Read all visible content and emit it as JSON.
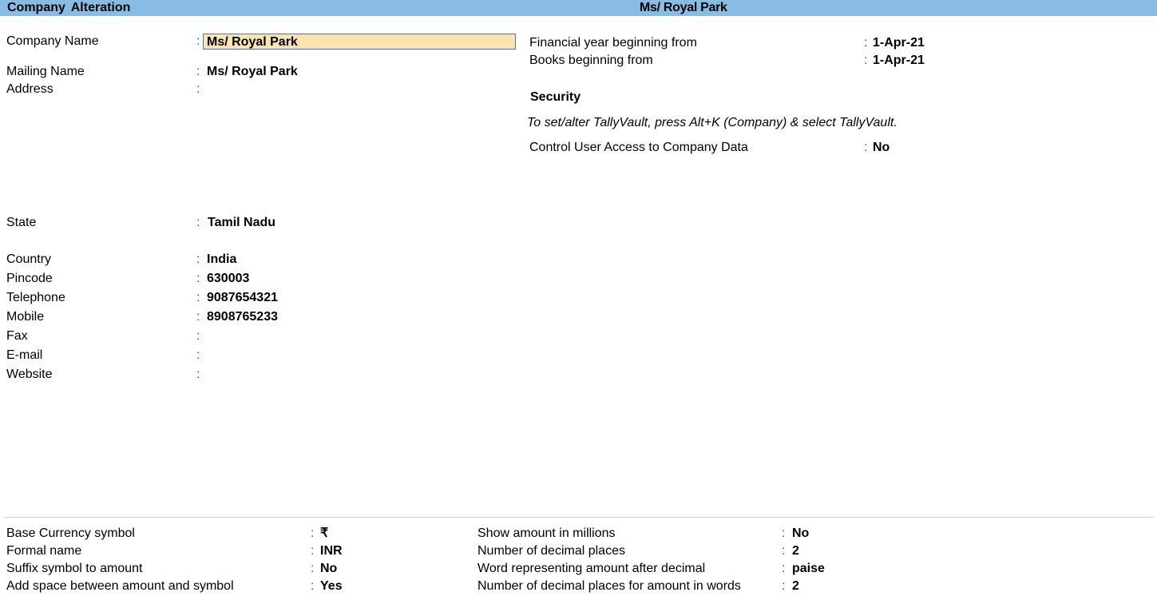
{
  "header": {
    "title": "Company  Alteration",
    "company": "Ms/ Royal Park"
  },
  "left_form": {
    "company_name": {
      "label": "Company Name",
      "value": "Ms/ Royal Park"
    },
    "mailing_name": {
      "label": "Mailing Name",
      "value": "Ms/ Royal Park"
    },
    "address": {
      "label": "Address",
      "value": ""
    },
    "state": {
      "label": "State",
      "value": "Tamil Nadu"
    },
    "country": {
      "label": "Country",
      "value": "India"
    },
    "pincode": {
      "label": "Pincode",
      "value": "630003"
    },
    "telephone": {
      "label": "Telephone",
      "value": "9087654321"
    },
    "mobile": {
      "label": "Mobile",
      "value": "8908765233"
    },
    "fax": {
      "label": "Fax",
      "value": ""
    },
    "email": {
      "label": "E-mail",
      "value": ""
    },
    "website": {
      "label": "Website",
      "value": ""
    }
  },
  "right_form": {
    "financial_year": {
      "label": "Financial year beginning from",
      "value": "1-Apr-21"
    },
    "books_beginning": {
      "label": "Books beginning from",
      "value": "1-Apr-21"
    },
    "security_heading": "Security",
    "security_note": "To set/alter TallyVault, press Alt+K (Company) & select TallyVault.",
    "control_access": {
      "label": "Control User Access to Company Data",
      "value": "No"
    }
  },
  "currency": {
    "base_symbol": {
      "label": "Base Currency symbol",
      "value": "₹"
    },
    "formal_name": {
      "label": "Formal name",
      "value": "INR"
    },
    "suffix_symbol": {
      "label": "Suffix symbol to amount",
      "value": "No"
    },
    "add_space": {
      "label": "Add space between amount and symbol",
      "value": "Yes"
    },
    "show_millions": {
      "label": "Show amount in millions",
      "value": "No"
    },
    "decimal_places": {
      "label": "Number of decimal places",
      "value": "2"
    },
    "decimal_word": {
      "label": "Word representing amount after decimal",
      "value": "paise"
    },
    "decimal_places_words": {
      "label": "Number of decimal places for amount in words",
      "value": "2"
    }
  },
  "colon": ":"
}
